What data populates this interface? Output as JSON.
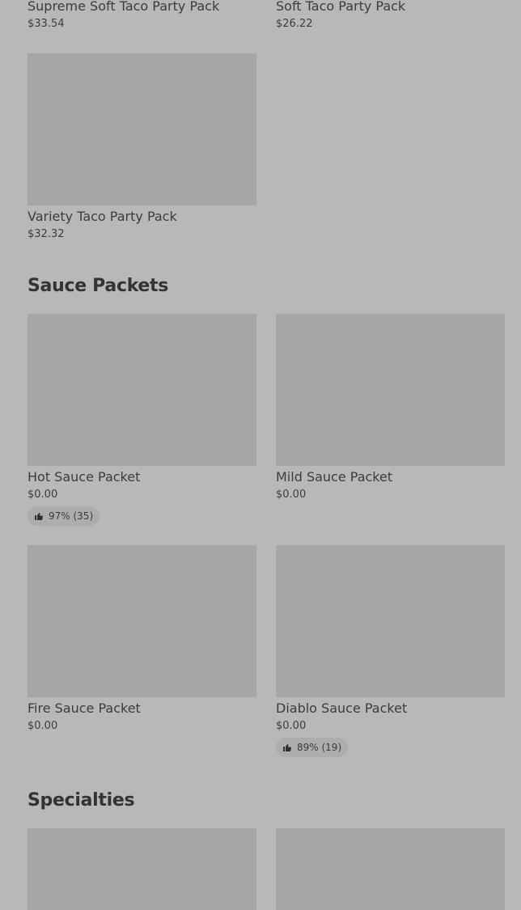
{
  "party_packs": {
    "items": [
      {
        "name": "Supreme Soft Taco Party Pack",
        "price": "$33.54"
      },
      {
        "name": "Soft Taco Party Pack",
        "price": "$26.22"
      },
      {
        "name": "Variety Taco Party Pack",
        "price": "$32.32"
      }
    ]
  },
  "sauce_packets": {
    "title": "Sauce Packets",
    "items": [
      {
        "name": "Hot Sauce Packet",
        "price": "$0.00",
        "rating": "97% (35)"
      },
      {
        "name": "Mild Sauce Packet",
        "price": "$0.00"
      },
      {
        "name": "Fire Sauce Packet",
        "price": "$0.00"
      },
      {
        "name": "Diablo Sauce Packet",
        "price": "$0.00",
        "rating": "89% (19)"
      }
    ]
  },
  "specialties": {
    "title": "Specialties"
  },
  "icons": {
    "rating": "thumbs-up-icon"
  },
  "colors": {
    "overlay": "#b8b8b8",
    "image_placeholder": "#a6a6a6",
    "text": "#3c3c3c"
  }
}
